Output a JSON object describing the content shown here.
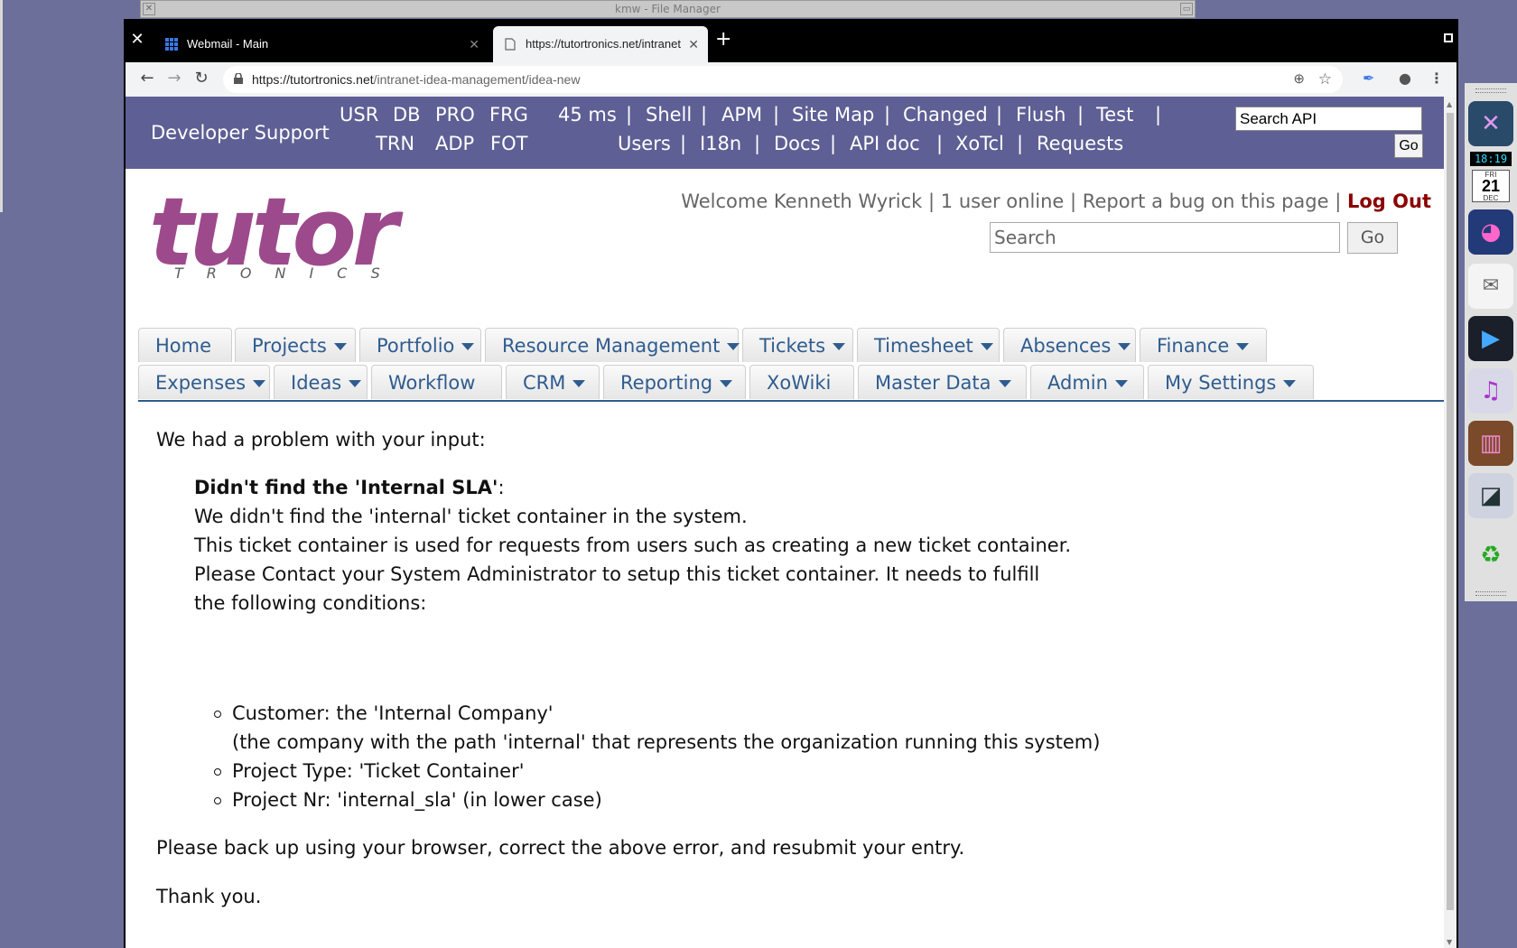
{
  "background_window": {
    "title": "kmw - File Manager"
  },
  "browser": {
    "tabs": [
      {
        "label": "Webmail - Main",
        "favicon": "grid-icon"
      },
      {
        "label": "https://tutortronics.net/intranet-idea-management/idea-new",
        "favicon": "page-icon"
      }
    ],
    "url_host": "https://tutortronics.net",
    "url_path": "/intranet-idea-management/idea-new"
  },
  "devbar": {
    "title": "Developer Support",
    "row1": [
      "USR",
      "DB",
      "PRO",
      "FRG"
    ],
    "row1b": [
      "45 ms",
      "Shell",
      "APM",
      "Site Map",
      "Changed",
      "Flush",
      "Test"
    ],
    "row2": [
      "TRN",
      "ADP",
      "FOT"
    ],
    "row2b": [
      "Users",
      "I18n",
      "Docs",
      "API doc",
      "XoTcl",
      "Requests"
    ],
    "search_value": "Search API",
    "go_label": "Go"
  },
  "logo": {
    "word": "tutor",
    "sub": "TRONICS"
  },
  "header": {
    "welcome": "Welcome Kenneth Wyrick",
    "sep": " | ",
    "users_online": "1 user online",
    "report_bug": "Report a bug on this page",
    "logout": "Log Out",
    "search_placeholder": "Search",
    "go_label": "Go"
  },
  "nav": {
    "row1": [
      {
        "label": "Home",
        "dropdown": false
      },
      {
        "label": "Projects",
        "dropdown": true
      },
      {
        "label": "Portfolio",
        "dropdown": true
      },
      {
        "label": "Resource Management",
        "dropdown": true
      },
      {
        "label": "Tickets",
        "dropdown": true
      },
      {
        "label": "Timesheet",
        "dropdown": true
      },
      {
        "label": "Absences",
        "dropdown": true
      },
      {
        "label": "Finance",
        "dropdown": true
      }
    ],
    "row2": [
      {
        "label": "Expenses",
        "dropdown": true
      },
      {
        "label": "Ideas",
        "dropdown": true
      },
      {
        "label": "Workflow",
        "dropdown": false
      },
      {
        "label": "CRM",
        "dropdown": true
      },
      {
        "label": "Reporting",
        "dropdown": true
      },
      {
        "label": "XoWiki",
        "dropdown": false
      },
      {
        "label": "Master Data",
        "dropdown": true
      },
      {
        "label": "Admin",
        "dropdown": true
      },
      {
        "label": "My Settings",
        "dropdown": true
      }
    ]
  },
  "content": {
    "intro": "We had a problem with your input:",
    "error_title": "Didn't find the 'Internal SLA'",
    "error_colon": ":",
    "lines": [
      "We didn't find the 'internal' ticket container in the system.",
      "This ticket container is used for requests from users such as creating a new ticket container.",
      "Please Contact your System Administrator to setup this ticket container. It needs to fulfill",
      "the following conditions:"
    ],
    "conditions": [
      "Customer: the 'Internal Company'",
      "(the company with the path 'internal' that represents the organization running this system)",
      "Project Type: 'Ticket Container'",
      "Project Nr: 'internal_sla' (in lower case)"
    ],
    "back_message": "Please back up using your browser, correct the above error, and resubmit your entry.",
    "thanks": "Thank you."
  },
  "dock": {
    "clock_time": "18:19",
    "calendar_day": "FRI",
    "calendar_date": "21",
    "calendar_month": "DEC"
  },
  "colors": {
    "devbar_bg": "#5e5f94",
    "logo": "#9d4a8c",
    "nav_link": "#2f5c8f",
    "logout": "#8b0000",
    "desktop": "#6b6f99"
  }
}
